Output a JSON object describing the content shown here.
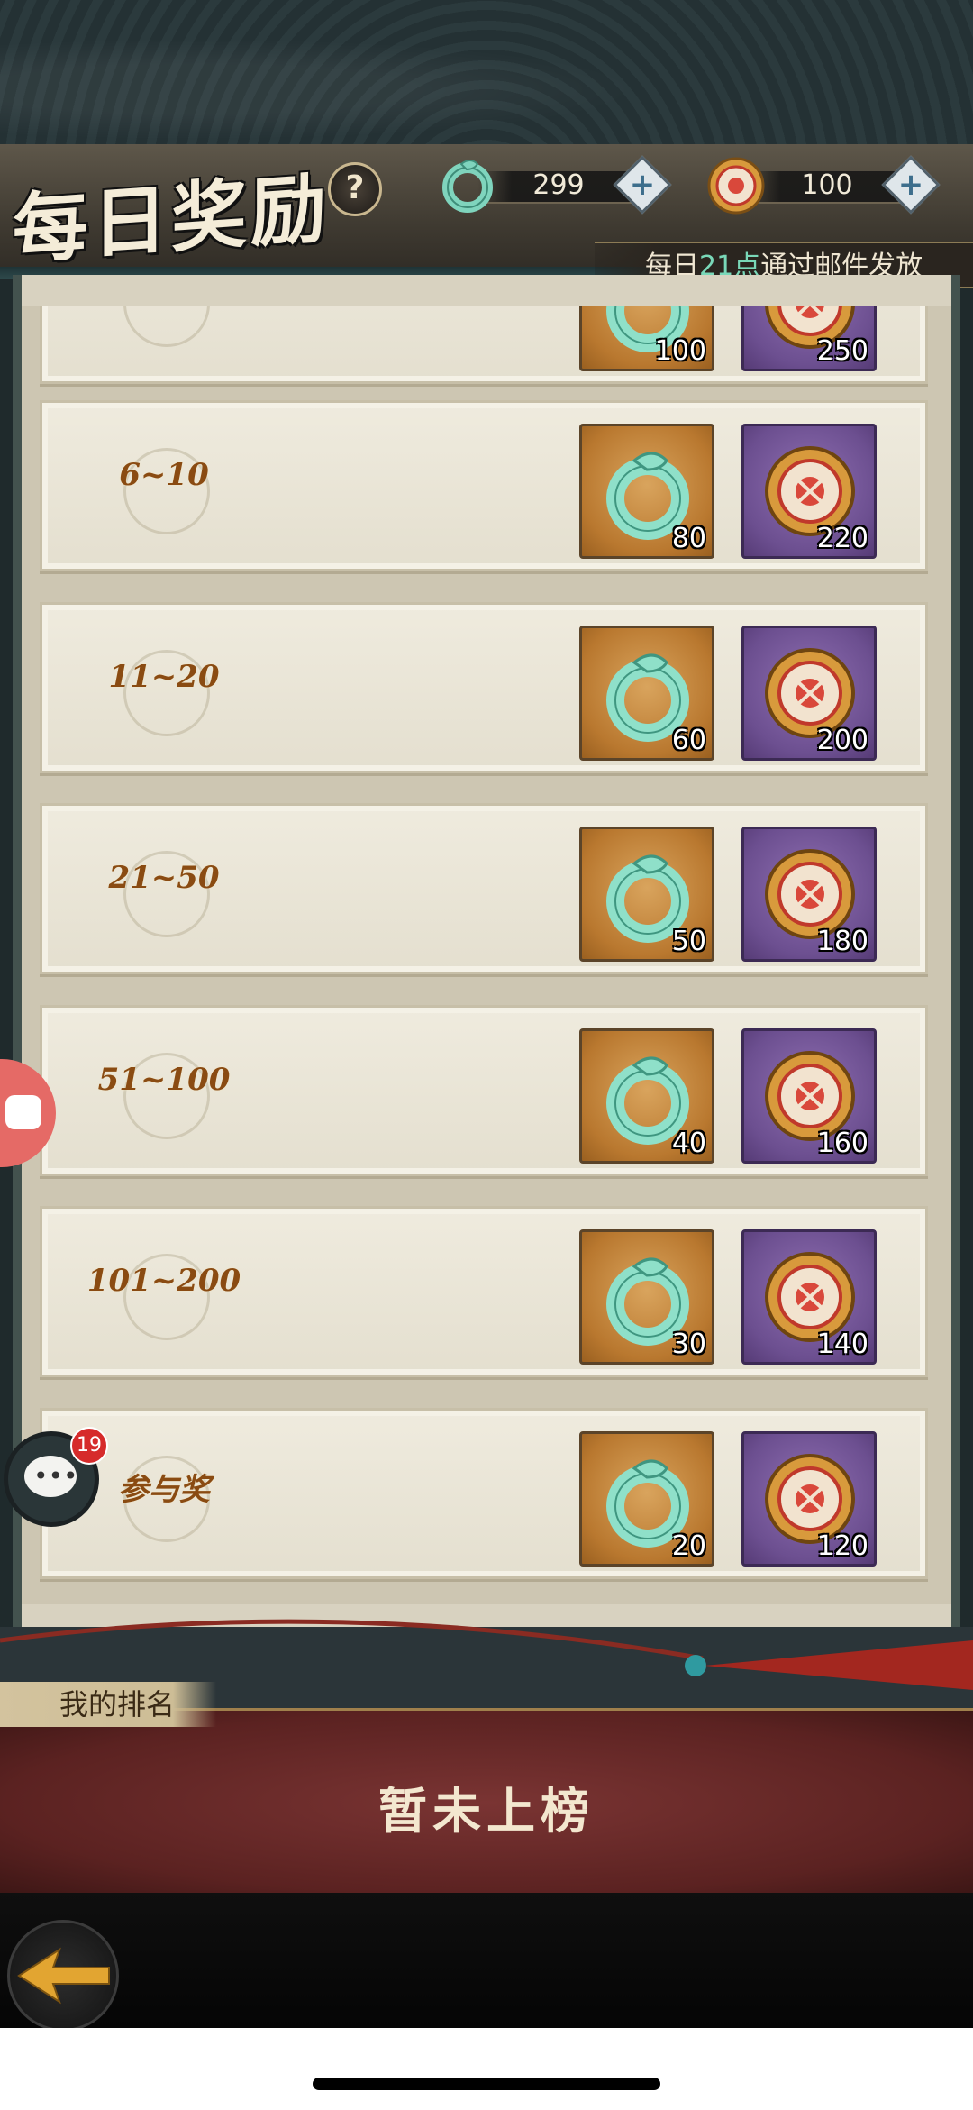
{
  "header": {
    "title": "每日奖励",
    "help_label": "?",
    "jade_amount": "299",
    "coin_amount": "100",
    "notice_prefix": "每日",
    "notice_hour": "21点",
    "notice_suffix": "通过邮件发放"
  },
  "rewards": [
    {
      "rank": "",
      "jade": "100",
      "coin": "250"
    },
    {
      "rank": "6~10",
      "jade": "80",
      "coin": "220"
    },
    {
      "rank": "11~20",
      "jade": "60",
      "coin": "200"
    },
    {
      "rank": "21~50",
      "jade": "50",
      "coin": "180"
    },
    {
      "rank": "51~100",
      "jade": "40",
      "coin": "160"
    },
    {
      "rank": "101~200",
      "jade": "30",
      "coin": "140"
    },
    {
      "rank": "参与奖",
      "jade": "20",
      "coin": "120"
    }
  ],
  "chat": {
    "badge_count": "19"
  },
  "my_rank": {
    "title": "我的排名",
    "status": "暂未上榜"
  },
  "colors": {
    "jade": "#7fd4bd",
    "gold_tile": "#c3843a",
    "purple_tile": "#7a5b9e",
    "rank_text": "#8a4b12",
    "notice_highlight": "#79d8b8"
  }
}
